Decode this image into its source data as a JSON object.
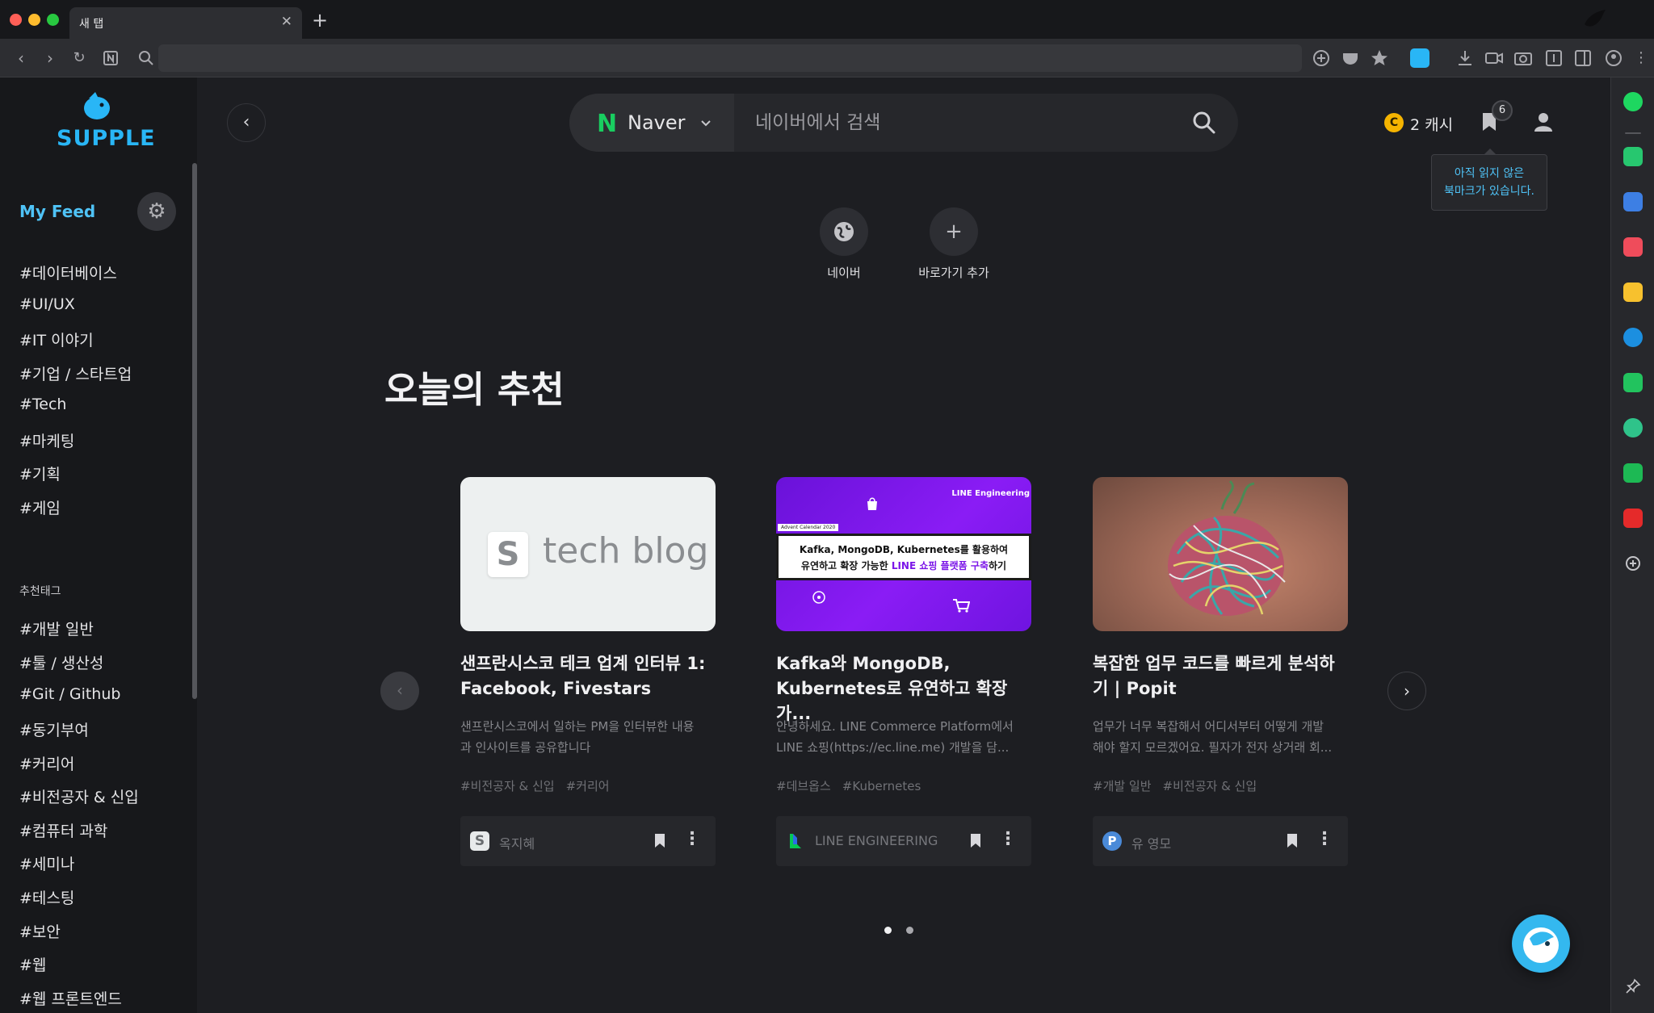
{
  "browser": {
    "tab_title": "새 탭",
    "tab_close": "✕",
    "new_tab": "+"
  },
  "sidebar": {
    "logo_text": "SUPPLE",
    "my_feed": "My Feed",
    "my_tags": [
      "#데이터베이스",
      "#UI/UX",
      "#IT 이야기",
      "#기업 / 스타트업",
      "#Tech",
      "#마케팅",
      "#기획",
      "#게임"
    ],
    "recommended_title": "추천태그",
    "recommended_tags": [
      "#개발 일반",
      "#툴 / 생산성",
      "#Git / Github",
      "#동기부여",
      "#커리어",
      "#비전공자 & 신입",
      "#컴퓨터 과학",
      "#세미나",
      "#테스팅",
      "#보안",
      "#웹",
      "#웹 프론트엔드"
    ]
  },
  "header": {
    "search_engine_letter": "N",
    "search_engine": "Naver",
    "search_placeholder": "네이버에서 검색",
    "cash_letter": "C",
    "cash": "2 캐시",
    "bookmark_count": "6",
    "tooltip_line1": "아직 읽지 않은",
    "tooltip_line2": "북마크가 있습니다."
  },
  "shortcuts": [
    {
      "label": "네이버"
    },
    {
      "label": "바로가기 추가",
      "glyph": "+"
    }
  ],
  "section_title": "오늘의 추천",
  "cards": [
    {
      "thumb_letter": "S",
      "thumb_text": "tech blog",
      "title": "샌프란시스코 테크 업계 인터뷰 1: Facebook, Fivestars",
      "desc": "샌프란시스코에서 일하는 PM을 인터뷰한 내용\n과 인사이트를 공유합니다",
      "tags": [
        "#비전공자 & 신입",
        "#커리어"
      ],
      "author": "옥지혜",
      "author_letter": "S"
    },
    {
      "thumb_brand": "LINE Engineering",
      "thumb_badge": "Advent Calendar 2020",
      "thumb_line1": "Kafka, MongoDB, Kubernetes를 활용하여",
      "thumb_line2_a": "유연하고 확장 가능한 ",
      "thumb_line2_b": "LINE 쇼핑 플랫폼 구축",
      "thumb_line2_c": "하기",
      "title": "Kafka와 MongoDB, Kubernetes로 유연하고 확장 가...",
      "desc": "안녕하세요. LINE Commerce Platform에서\nLINE 쇼핑(https://ec.line.me) 개발을 담...",
      "tags": [
        "#데브옵스",
        "#Kubernetes"
      ],
      "author": "LINE ENGINEERING"
    },
    {
      "title": "복잡한 업무 코드를 빠르게 분석하기 | Popit",
      "desc": "업무가 너무 복잡해서 어디서부터 어떻게 개발\n해야 할지 모르겠어요. 필자가 전자 상거래 회...",
      "tags": [
        "#개발 일반",
        "#비전공자 & 신입"
      ],
      "author": "유 영모",
      "author_letter": "P"
    }
  ],
  "colors": {
    "accent": "#29b6f6",
    "naver_green": "#19ce60",
    "cash_gold": "#f5b400",
    "line_purple": "#7b16e8"
  },
  "icons": {
    "back": "chevron-left-icon",
    "search": "search-icon",
    "settings": "gear-icon",
    "bookmark": "bookmark-icon",
    "user": "user-icon",
    "more": "more-vertical-icon"
  }
}
